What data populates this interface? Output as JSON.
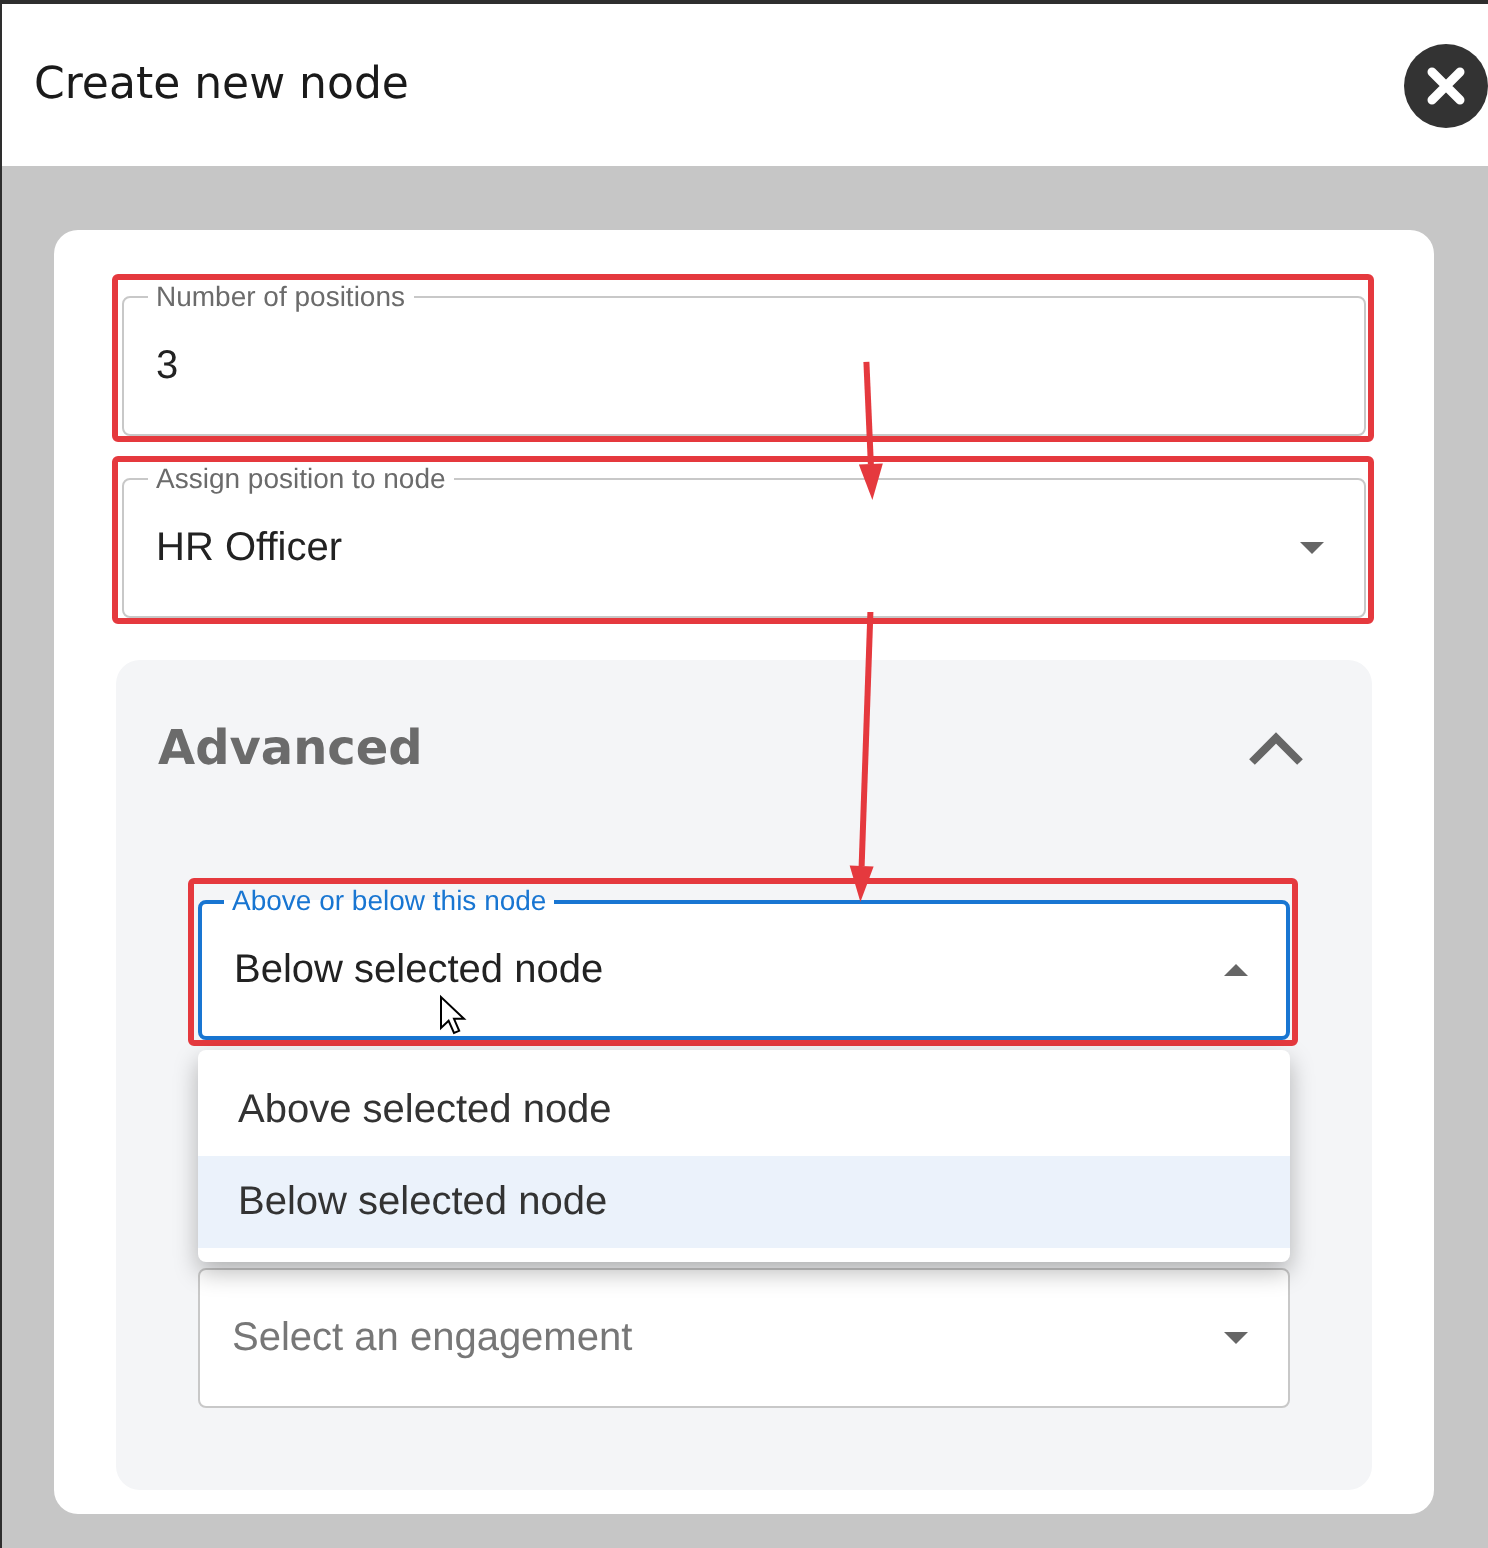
{
  "dialog": {
    "title": "Create new node"
  },
  "fields": [
    {
      "kind": "text",
      "label": "Number of positions",
      "value": "3",
      "focused": false,
      "highlighted": true
    },
    {
      "kind": "select",
      "label": "Assign position to node",
      "value": "HR Officer",
      "focused": false,
      "expanded": false,
      "highlighted": true
    }
  ],
  "advanced": {
    "title": "Advanced",
    "expanded": true,
    "fields": [
      {
        "kind": "select",
        "label": "Above or below this node",
        "value": "Below selected node",
        "focused": true,
        "expanded": true,
        "highlighted": true,
        "options": [
          {
            "label": "Above selected node",
            "selected": false
          },
          {
            "label": "Below selected node",
            "selected": true
          }
        ]
      },
      {
        "kind": "select",
        "placeholder": "Select an engagement",
        "focused": false,
        "expanded": false,
        "highlighted": false
      }
    ]
  }
}
